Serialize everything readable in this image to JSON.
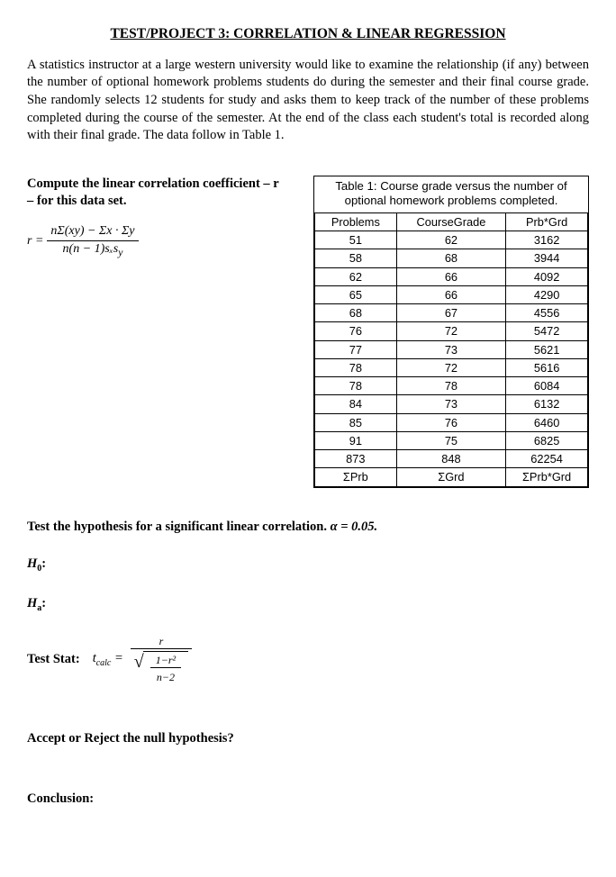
{
  "title": "TEST/PROJECT 3: CORRELATION & LINEAR REGRESSION",
  "intro": "A statistics instructor at a large western university would like to examine the relationship (if any) between the number of optional homework problems students do during the semester and their final course grade.  She randomly selects 12 students for study and asks them to keep track of the number of these problems completed during the course of the semester.  At the end of the class each student's total is recorded along with their final grade.  The data follow in Table 1.",
  "prompt_compute": "Compute the linear correlation coefficient – r – for this data set.",
  "formula_r_lhs": "r =",
  "formula_r_num": "nΣ(xy) − Σx · Σy",
  "formula_r_den": "n(n − 1)sₓs",
  "formula_r_den_suffix": "y",
  "table_caption": "Table 1: Course grade versus the number of optional homework problems completed.",
  "headers": {
    "c1": "Problems",
    "c2": "CourseGrade",
    "c3": "Prb*Grd"
  },
  "rows": [
    {
      "p": "51",
      "g": "62",
      "pg": "3162"
    },
    {
      "p": "58",
      "g": "68",
      "pg": "3944"
    },
    {
      "p": "62",
      "g": "66",
      "pg": "4092"
    },
    {
      "p": "65",
      "g": "66",
      "pg": "4290"
    },
    {
      "p": "68",
      "g": "67",
      "pg": "4556"
    },
    {
      "p": "76",
      "g": "72",
      "pg": "5472"
    },
    {
      "p": "77",
      "g": "73",
      "pg": "5621"
    },
    {
      "p": "78",
      "g": "72",
      "pg": "5616"
    },
    {
      "p": "78",
      "g": "78",
      "pg": "6084"
    },
    {
      "p": "84",
      "g": "73",
      "pg": "6132"
    },
    {
      "p": "85",
      "g": "76",
      "pg": "6460"
    },
    {
      "p": "91",
      "g": "75",
      "pg": "6825"
    }
  ],
  "sums": {
    "p": "873",
    "g": "848",
    "pg": "62254"
  },
  "sum_labels": {
    "p": "ΣPrb",
    "g": "ΣGrd",
    "pg": "ΣPrb*Grd"
  },
  "test_prefix": "Test the hypothesis for a significant linear correlation.  ",
  "alpha_label": "α = 0.05.",
  "h0": "H",
  "h0_sub": "0",
  "h0_suffix": ":",
  "ha": "H",
  "ha_sub": "a",
  "ha_suffix": ":",
  "test_stat_label": "Test Stat:",
  "tcalc_t": "t",
  "tcalc_sub": "calc",
  "tcalc_eq": " =",
  "tcalc_num": "r",
  "tcalc_inner_num": "1−r²",
  "tcalc_inner_den": "n−2",
  "accept_reject": "Accept or Reject the null hypothesis?",
  "conclusion": "Conclusion:"
}
